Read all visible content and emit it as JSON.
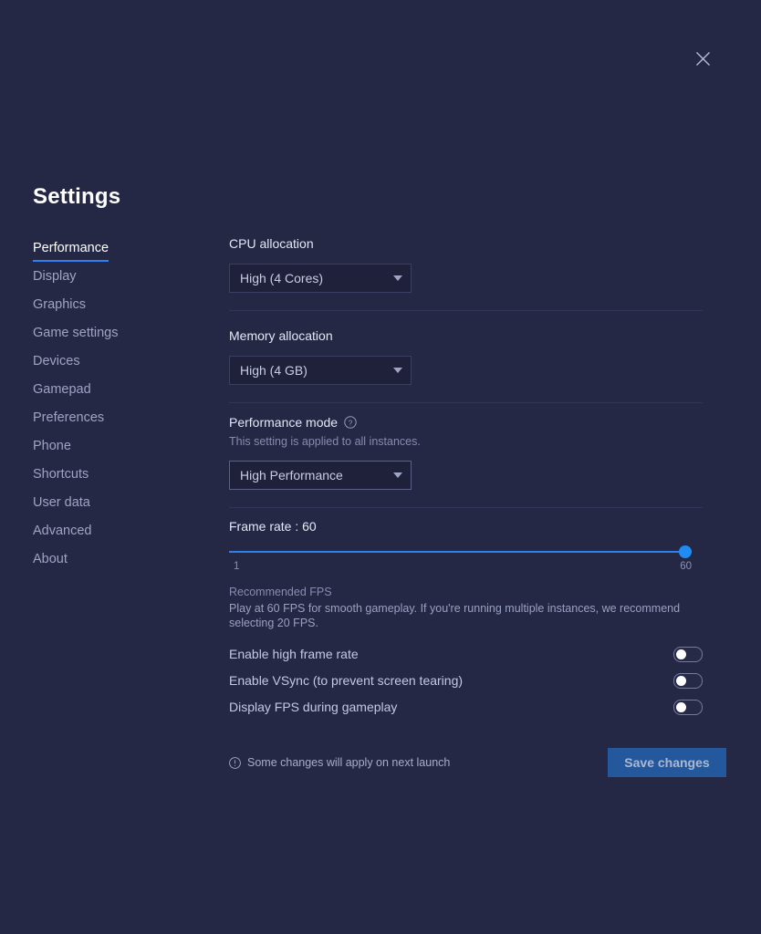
{
  "window": {
    "close_icon": "close-icon"
  },
  "page_title": "Settings",
  "sidebar": {
    "items": [
      {
        "label": "Performance",
        "active": true
      },
      {
        "label": "Display",
        "active": false
      },
      {
        "label": "Graphics",
        "active": false
      },
      {
        "label": "Game settings",
        "active": false
      },
      {
        "label": "Devices",
        "active": false
      },
      {
        "label": "Gamepad",
        "active": false
      },
      {
        "label": "Preferences",
        "active": false
      },
      {
        "label": "Phone",
        "active": false
      },
      {
        "label": "Shortcuts",
        "active": false
      },
      {
        "label": "User data",
        "active": false
      },
      {
        "label": "Advanced",
        "active": false
      },
      {
        "label": "About",
        "active": false
      }
    ]
  },
  "main": {
    "cpu": {
      "label": "CPU allocation",
      "value": "High (4 Cores)"
    },
    "memory": {
      "label": "Memory allocation",
      "value": "High (4 GB)"
    },
    "performance_mode": {
      "label": "Performance mode",
      "help_icon": "help-circle-icon",
      "note": "This setting is applied to all instances.",
      "value": "High Performance"
    },
    "frame_rate": {
      "label": "Frame rate : 60",
      "value": 60,
      "min_label": "1",
      "max_label": "60",
      "min": 1,
      "max": 60,
      "rec_title": "Recommended FPS",
      "rec_body": "Play at 60 FPS for smooth gameplay. If you're running multiple instances, we recommend selecting 20 FPS."
    },
    "toggles": [
      {
        "label": "Enable high frame rate",
        "on": false
      },
      {
        "label": "Enable VSync (to prevent screen tearing)",
        "on": false
      },
      {
        "label": "Display FPS during gameplay",
        "on": false
      }
    ],
    "footer": {
      "info_icon": "info-circle-icon",
      "note": "Some changes will apply on next launch",
      "save_label": "Save changes"
    }
  },
  "colors": {
    "background": "#252845",
    "accent": "#2f7ff0",
    "slider_thumb": "#1f8bf5",
    "save_button": "#23599c",
    "field_background": "#1e2139"
  }
}
